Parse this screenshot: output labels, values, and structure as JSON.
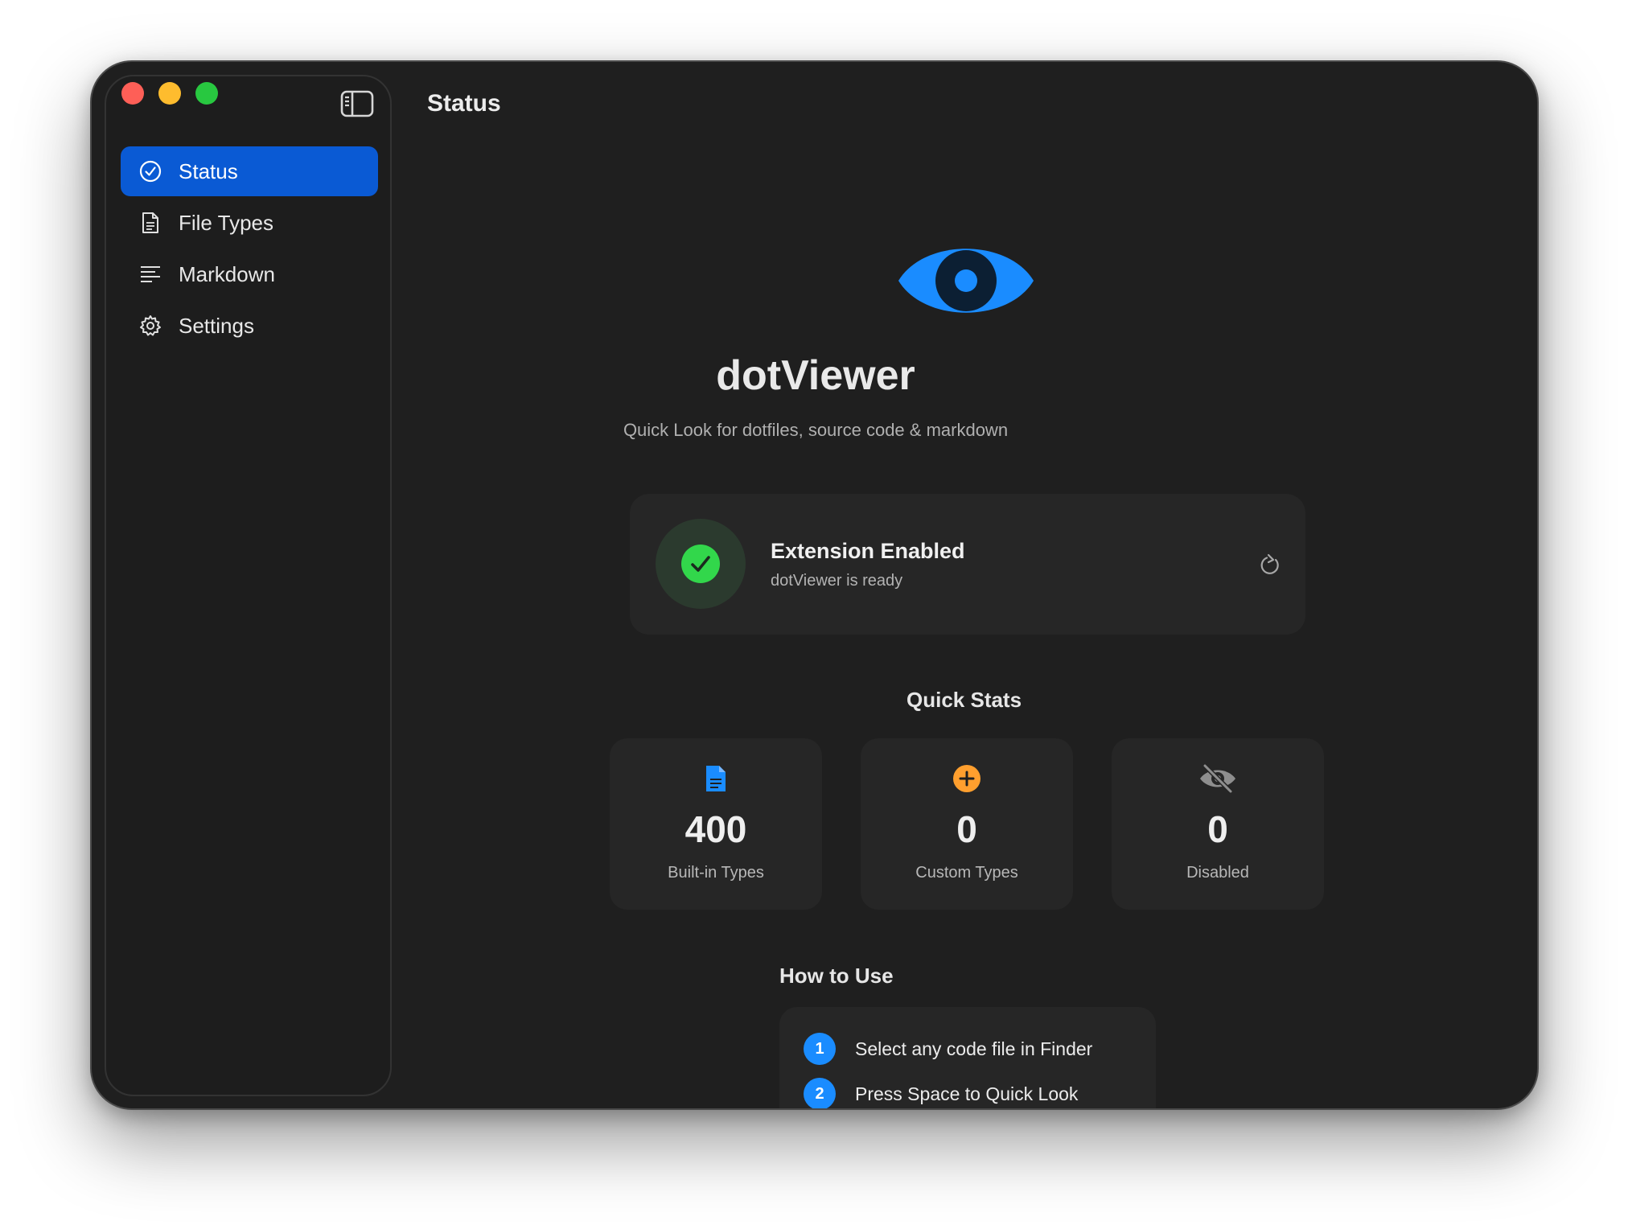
{
  "window": {
    "title": "Status",
    "traffic_lights": [
      "close",
      "minimize",
      "zoom"
    ]
  },
  "sidebar": {
    "items": [
      {
        "label": "Status",
        "icon": "checkmark-circle-icon",
        "active": true
      },
      {
        "label": "File Types",
        "icon": "document-icon",
        "active": false
      },
      {
        "label": "Markdown",
        "icon": "text-align-left-icon",
        "active": false
      },
      {
        "label": "Settings",
        "icon": "gear-icon",
        "active": false
      }
    ]
  },
  "hero": {
    "app_name": "dotViewer",
    "tagline": "Quick Look for dotfiles, source code & markdown"
  },
  "status": {
    "title": "Extension Enabled",
    "subtitle": "dotViewer is ready"
  },
  "quick_stats": {
    "title": "Quick Stats",
    "cards": [
      {
        "value": "400",
        "label": "Built-in Types",
        "icon": "document-icon",
        "color": "#1a8cff"
      },
      {
        "value": "0",
        "label": "Custom Types",
        "icon": "plus-circle-icon",
        "color": "#ff9f2e"
      },
      {
        "value": "0",
        "label": "Disabled",
        "icon": "eye-slash-icon",
        "color": "#8e8e8e"
      }
    ]
  },
  "how_to_use": {
    "title": "How to Use",
    "steps": [
      {
        "number": "1",
        "text": "Select any code file in Finder"
      },
      {
        "number": "2",
        "text": "Press Space to Quick Look"
      }
    ]
  },
  "colors": {
    "accent": "#0a5ad4",
    "brand_blue": "#1a8cff",
    "success": "#32d74b",
    "warning": "#ff9f2e"
  }
}
